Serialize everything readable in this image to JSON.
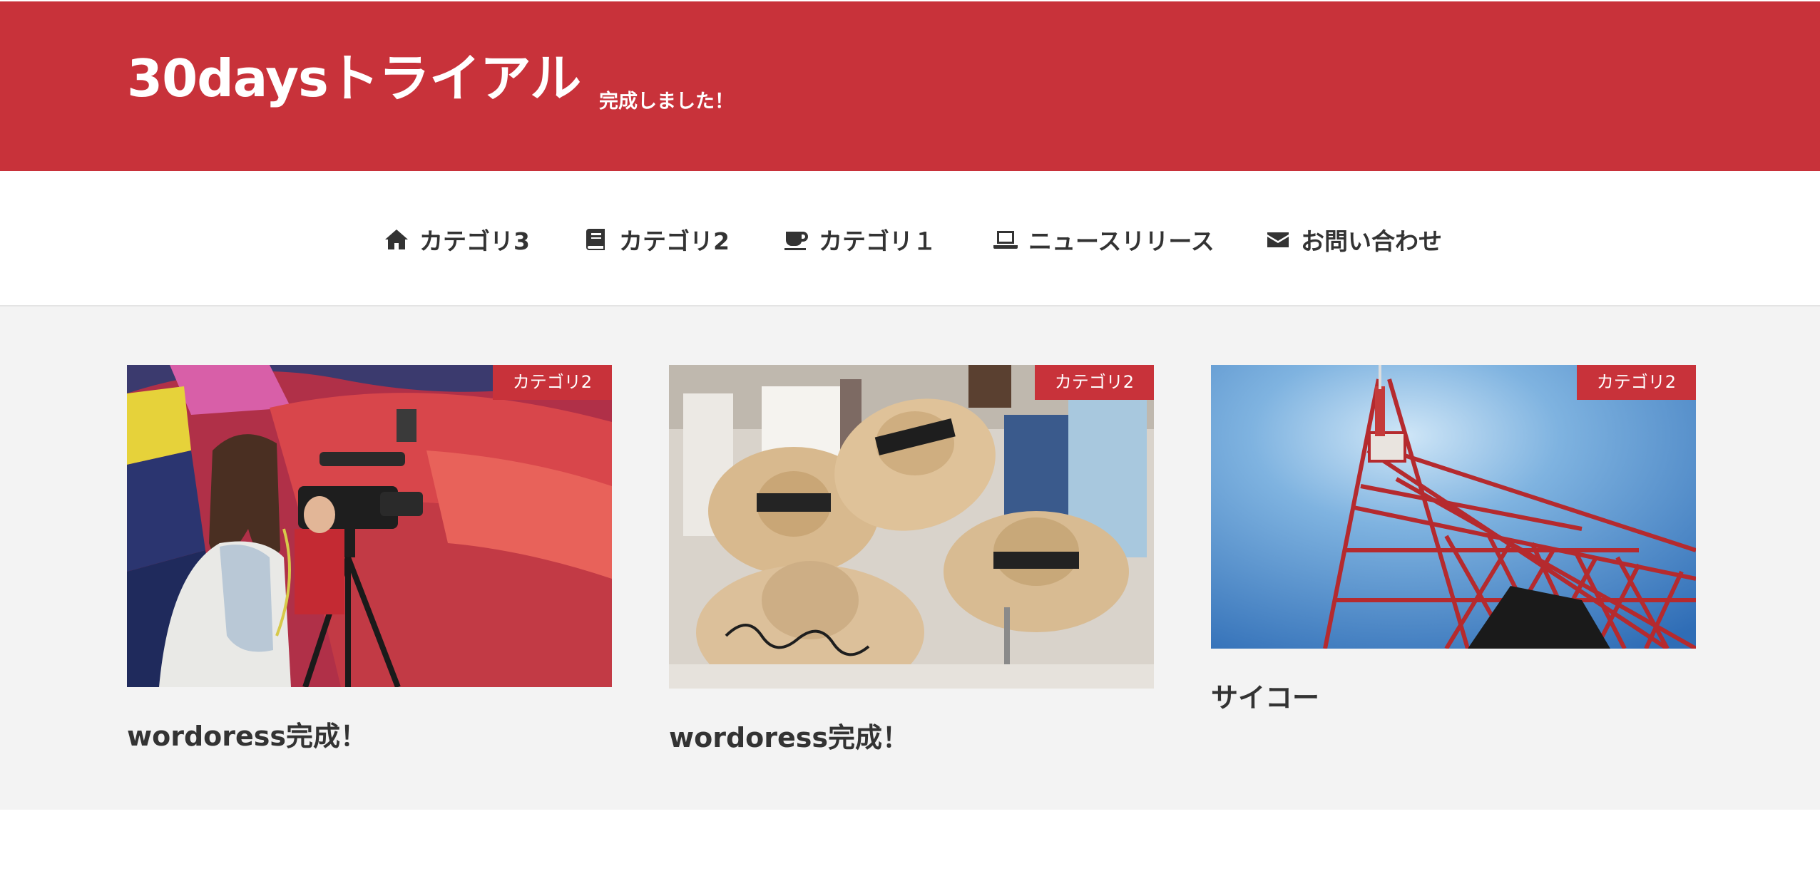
{
  "header": {
    "site_title": "30daysトライアル",
    "tagline": "完成しました！",
    "accent_color": "#c8323a"
  },
  "nav": {
    "items": [
      {
        "label": "カテゴリ3",
        "icon": "home-icon"
      },
      {
        "label": "カテゴリ2",
        "icon": "book-icon"
      },
      {
        "label": "カテゴリ１",
        "icon": "coffee-cup-icon"
      },
      {
        "label": "ニュースリリース",
        "icon": "laptop-icon"
      },
      {
        "label": "お問い合わせ",
        "icon": "envelope-icon"
      }
    ]
  },
  "posts": [
    {
      "category": "カテゴリ2",
      "title": "wordoress完成！",
      "image": "photo of a woman filming with a video camera in front of a hot air balloon"
    },
    {
      "category": "カテゴリ2",
      "title": "wordoress完成！",
      "image": "photo of straw hats on display in a clothing store"
    },
    {
      "category": "カテゴリ2",
      "title": "サイコー",
      "image": "photo of Tokyo Tower against a blue sky"
    }
  ]
}
